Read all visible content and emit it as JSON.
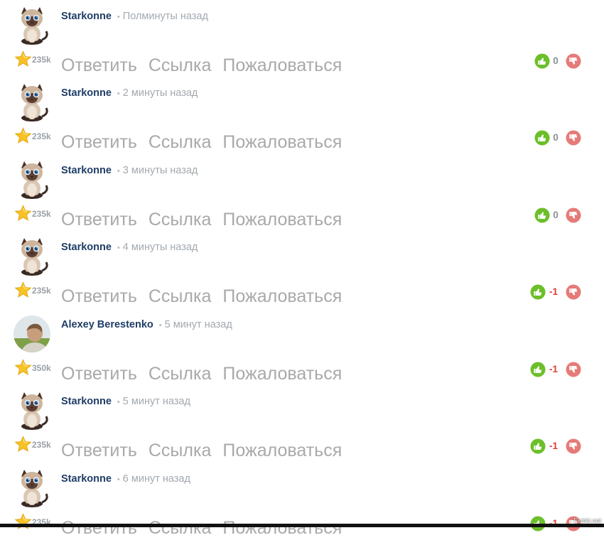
{
  "actions": {
    "reply": "Ответить",
    "link": "Ссылка",
    "report": "Пожаловаться"
  },
  "colors": {
    "author": "#1f3d66",
    "upvote": "#6cbf2a",
    "downvote": "#e57b78",
    "negative": "#e03a3a",
    "action": "#a9a9a9"
  },
  "comments": [
    {
      "author": "Starkonne",
      "time": "Полминуты назад",
      "rating": "235k",
      "score": "0",
      "avatar": "cat-avatar"
    },
    {
      "author": "Starkonne",
      "time": "2 минуты назад",
      "rating": "235k",
      "score": "0",
      "avatar": "cat-avatar"
    },
    {
      "author": "Starkonne",
      "time": "3 минуты назад",
      "rating": "235k",
      "score": "0",
      "avatar": "cat-avatar"
    },
    {
      "author": "Starkonne",
      "time": "4 минуты назад",
      "rating": "235k",
      "score": "-1",
      "avatar": "cat-avatar"
    },
    {
      "author": "Alexey Berestenko",
      "time": "5 минут назад",
      "rating": "350k",
      "score": "-1",
      "avatar": "photo-avatar"
    },
    {
      "author": "Starkonne",
      "time": "5 минут назад",
      "rating": "235k",
      "score": "-1",
      "avatar": "cat-avatar"
    },
    {
      "author": "Starkonne",
      "time": "6 минут назад",
      "rating": "235k",
      "score": "-1",
      "avatar": "cat-avatar"
    }
  ],
  "watermark": "Fishki.net"
}
